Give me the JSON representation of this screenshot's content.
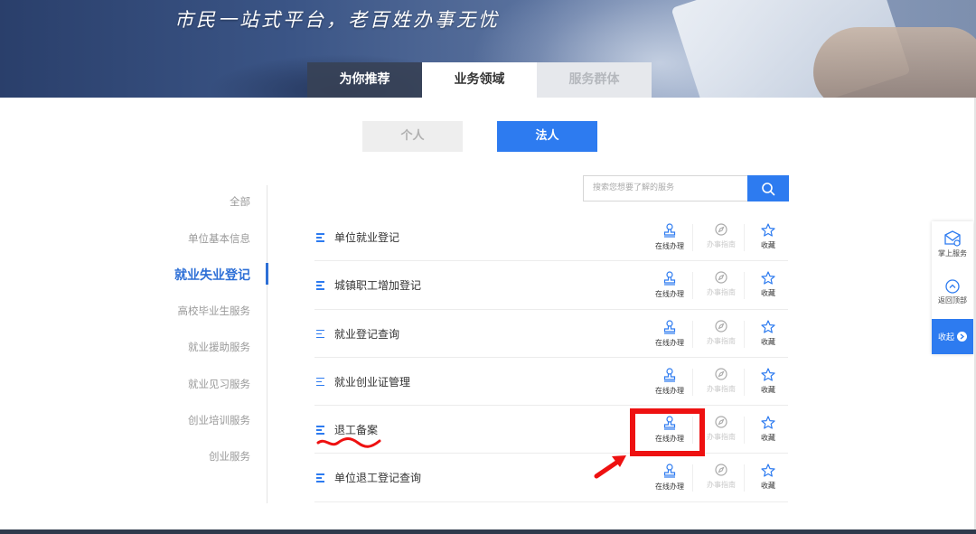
{
  "banner": {
    "slogan": "市民一站式平台，老百姓办事无忧"
  },
  "top_tabs": [
    {
      "label": "为你推荐",
      "state": "dark"
    },
    {
      "label": "业务领域",
      "state": "active"
    },
    {
      "label": "服务群体",
      "state": "disabled"
    }
  ],
  "type_toggle": {
    "personal": "个人",
    "legal": "法人",
    "selected": "法人"
  },
  "sidebar": {
    "items": [
      {
        "label": "全部"
      },
      {
        "label": "单位基本信息"
      },
      {
        "label": "就业失业登记",
        "active": true
      },
      {
        "label": "高校毕业生服务"
      },
      {
        "label": "就业援助服务"
      },
      {
        "label": "就业见习服务"
      },
      {
        "label": "创业培训服务"
      },
      {
        "label": "创业服务"
      }
    ]
  },
  "search": {
    "placeholder": "搜索您想要了解的服务",
    "icon": "search-icon"
  },
  "actions": {
    "online": "在线办理",
    "guide": "办事指南",
    "favorite": "收藏"
  },
  "services": [
    {
      "title": "单位就业登记"
    },
    {
      "title": "城镇职工增加登记"
    },
    {
      "title": "就业登记查询"
    },
    {
      "title": "就业创业证管理"
    },
    {
      "title": "退工备案",
      "annotated": true
    },
    {
      "title": "单位退工登记查询"
    }
  ],
  "float_panel": {
    "mobile_service": "掌上服务",
    "back_to_top": "返回顶部",
    "collapse": "收起"
  },
  "colors": {
    "primary": "#2d7bf0",
    "annotation": "#ee1111",
    "active_text": "#2d6fd6"
  }
}
